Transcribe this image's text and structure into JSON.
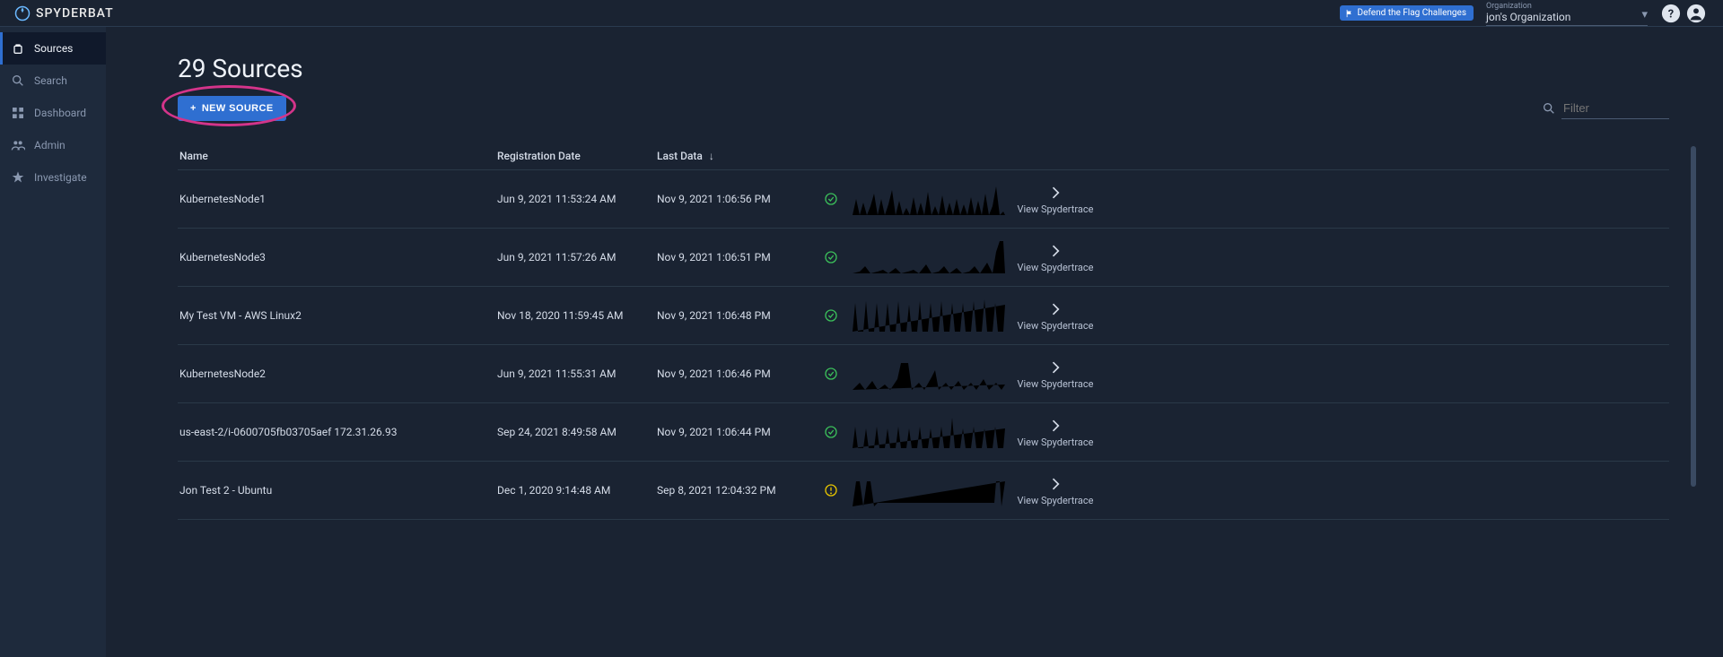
{
  "header": {
    "brand": "SPYDERBAT",
    "flag_challenges": "Defend the Flag Challenges",
    "org_label": "Organization",
    "org_name": "jon's Organization"
  },
  "sidebar": {
    "items": [
      {
        "label": "Sources",
        "icon": "battery-icon",
        "active": true
      },
      {
        "label": "Search",
        "icon": "search-icon",
        "active": false
      },
      {
        "label": "Dashboard",
        "icon": "dashboard-icon",
        "active": false
      },
      {
        "label": "Admin",
        "icon": "users-icon",
        "active": false
      },
      {
        "label": "Investigate",
        "icon": "star-icon",
        "active": false
      }
    ]
  },
  "page": {
    "title": "29 Sources",
    "new_source_button": "NEW SOURCE",
    "filter_placeholder": "Filter"
  },
  "table": {
    "headers": {
      "name": "Name",
      "registration": "Registration Date",
      "last_data": "Last Data",
      "action": "View Spydertrace"
    },
    "rows": [
      {
        "name": "KubernetesNode1",
        "registration": "Jun 9, 2021 11:53:24 AM",
        "last_data": "Nov 9, 2021 1:06:56 PM",
        "status": "ok",
        "spark": 1
      },
      {
        "name": "KubernetesNode3",
        "registration": "Jun 9, 2021 11:57:26 AM",
        "last_data": "Nov 9, 2021 1:06:51 PM",
        "status": "ok",
        "spark": 2
      },
      {
        "name": "My Test VM - AWS Linux2",
        "registration": "Nov 18, 2020 11:59:45 AM",
        "last_data": "Nov 9, 2021 1:06:48 PM",
        "status": "ok",
        "spark": 3
      },
      {
        "name": "KubernetesNode2",
        "registration": "Jun 9, 2021 11:55:31 AM",
        "last_data": "Nov 9, 2021 1:06:46 PM",
        "status": "ok",
        "spark": 4
      },
      {
        "name": "us-east-2/i-0600705fb03705aef 172.31.26.93",
        "registration": "Sep 24, 2021 8:49:58 AM",
        "last_data": "Nov 9, 2021 1:06:44 PM",
        "status": "ok",
        "spark": 5
      },
      {
        "name": "Jon Test 2 - Ubuntu",
        "registration": "Dec 1, 2020 9:14:48 AM",
        "last_data": "Sep 8, 2021 12:04:32 PM",
        "status": "warn",
        "spark": 6
      }
    ]
  }
}
